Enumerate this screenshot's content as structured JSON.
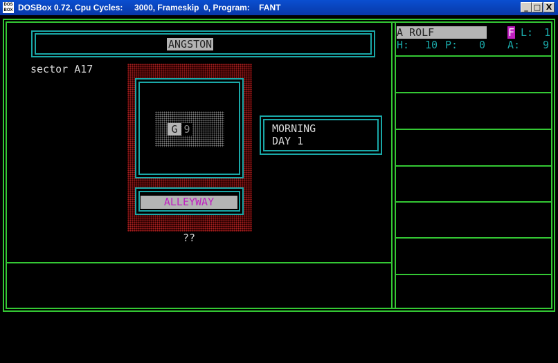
{
  "window": {
    "icon_label": "DOS BOX",
    "title": "DOSBox 0.72, Cpu Cycles:     3000, Frameskip  0, Program:    FANT",
    "min_glyph": "_",
    "max_glyph": "□",
    "close_glyph": "X"
  },
  "game": {
    "town_name": "ANGSTON",
    "sector": "sector A17",
    "map_cells": [
      "G",
      "9"
    ],
    "location": "ALLEYWAY",
    "unknown": "??",
    "time_of_day": "MORNING",
    "day": "DAY 1"
  },
  "party": {
    "slot1": {
      "name": "A ROLF",
      "flag": "F",
      "level_label": "L:",
      "level_value": "1",
      "hp_label": "H:",
      "hp_value": "10",
      "p_label": "P:",
      "p_value": "0",
      "a_label": "A:",
      "a_value": "9"
    }
  },
  "colors": {
    "green": "#34c834",
    "cyan": "#1aa8a8",
    "magenta": "#c020c0",
    "gray": "#b4b4b4",
    "dark_red": "#8b1a1a"
  }
}
